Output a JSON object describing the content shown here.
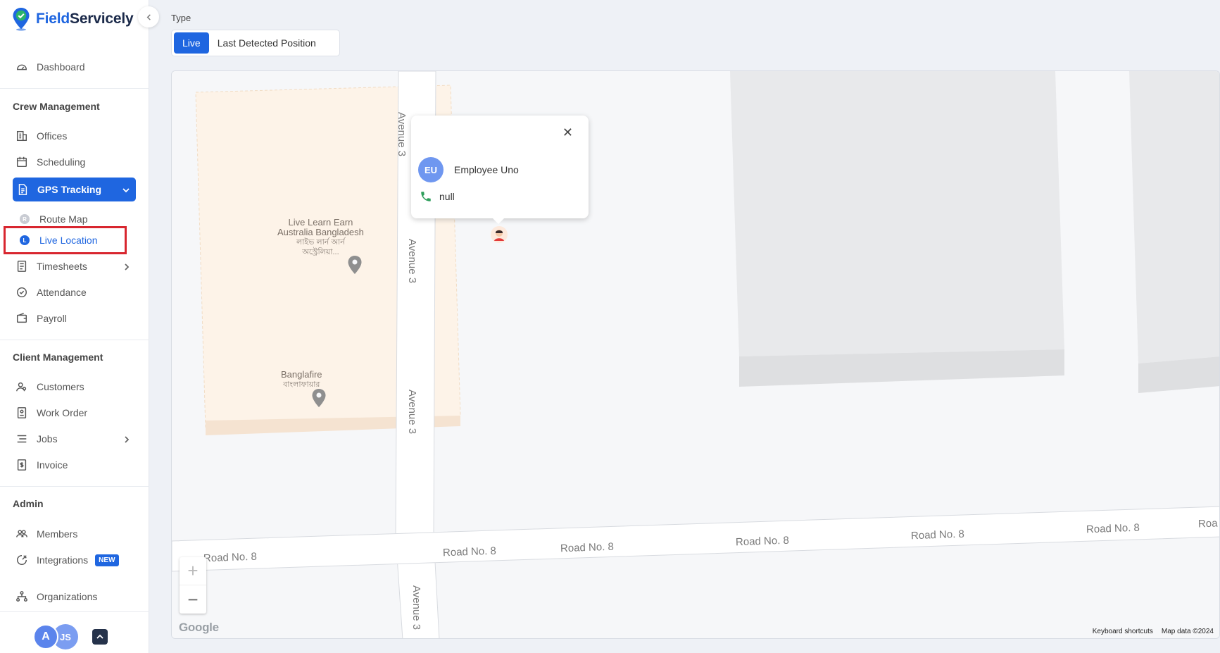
{
  "brand": {
    "name_part1": "Field",
    "name_part2": "Servicely"
  },
  "sidebar": {
    "dashboard": "Dashboard",
    "crew_section": "Crew Management",
    "offices": "Offices",
    "scheduling": "Scheduling",
    "gps_tracking": "GPS Tracking",
    "route_map": "Route Map",
    "route_map_dot": "R",
    "live_location": "Live Location",
    "live_location_dot": "L",
    "timesheets": "Timesheets",
    "attendance": "Attendance",
    "payroll": "Payroll",
    "client_section": "Client Management",
    "customers": "Customers",
    "work_order": "Work Order",
    "jobs": "Jobs",
    "invoice": "Invoice",
    "admin_section": "Admin",
    "members": "Members",
    "integrations": "Integrations",
    "integrations_badge": "NEW",
    "organizations": "Organizations"
  },
  "footer": {
    "avatar1": "A",
    "avatar2": "JS"
  },
  "type_filter": {
    "label": "Type",
    "options": [
      "Live",
      "Last Detected Position"
    ],
    "selected": "Live"
  },
  "map": {
    "popup": {
      "initials": "EU",
      "name": "Employee Uno",
      "phone": "null"
    },
    "streets": {
      "avenue": "Avenue 3",
      "road": "Road No. 8",
      "road_left": "Road No. 8",
      "road_cut": "Roa"
    },
    "poi1": {
      "line1": "Live Learn Earn",
      "line2": "Australia Bangladesh",
      "line3": "লাইভ লার্ন আর্ন",
      "line4": "অস্ট্রেলিয়া..."
    },
    "poi2": {
      "line1": "Banglafire",
      "line2": "বাংলাফায়ার"
    },
    "zoom_in": "+",
    "zoom_out": "−",
    "google": "Google",
    "keyboard_shortcuts": "Keyboard shortcuts",
    "map_data": "Map data ©2024"
  },
  "colors": {
    "accent": "#1f66e0",
    "highlight": "#d8262f",
    "sidebar_bg": "#ffffff"
  }
}
